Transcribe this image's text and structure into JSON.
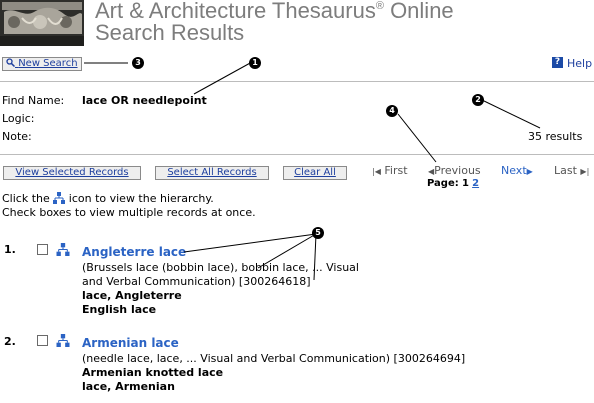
{
  "header": {
    "title_line1": "Art & Architecture Thesaurus",
    "title_reg": "®",
    "title_online": " Online",
    "title_line2": "Search Results"
  },
  "toolbar": {
    "new_search_label": "New Search",
    "help_label": "Help",
    "help_icon_glyph": "?"
  },
  "query": {
    "find_name_label": "Find Name:",
    "find_name_value": "lace OR needlepoint",
    "logic_label": "Logic:",
    "note_label": "Note:",
    "results_count": "35 results"
  },
  "actions": {
    "view_selected_label": "View Selected Records",
    "select_all_label": "Select All Records",
    "clear_all_label": "Clear All"
  },
  "pagination": {
    "first_label": "First",
    "previous_label": "Previous",
    "next_label": "Next",
    "last_label": "Last",
    "page_label": "Page:",
    "current_page": "1",
    "other_page": "2"
  },
  "instructions": {
    "line1_before": "Click the",
    "line1_after": "icon to view the hierarchy.",
    "line2": "Check boxes to view multiple records at once."
  },
  "callouts": [
    "1",
    "2",
    "3",
    "4",
    "5"
  ],
  "records": [
    {
      "number": "1.",
      "title": "Angleterre lace",
      "context_line1": "(Brussels lace (bobbin lace), bobbin lace, ... Visual",
      "context_line2": "and Verbal Communication) [300264618]",
      "alt_terms": [
        "lace, Angleterre",
        "English lace"
      ]
    },
    {
      "number": "2.",
      "title": "Armenian lace",
      "context_line1": "(needle lace, lace, ... Visual and Verbal Communication) [300264694]",
      "alt_terms": [
        "Armenian knotted lace",
        "lace, Armenian"
      ]
    }
  ],
  "icons": {
    "hierarchy": "hierarchy-icon",
    "magnifier": "magnifier-icon",
    "help": "help-icon",
    "first": "first-arrow-icon",
    "previous": "previous-arrow-icon",
    "next": "next-arrow-icon",
    "last": "last-arrow-icon"
  },
  "colors": {
    "link": "#2b63c4",
    "title_gray": "#7d7d7d",
    "button_bg": "#eeeeee"
  }
}
